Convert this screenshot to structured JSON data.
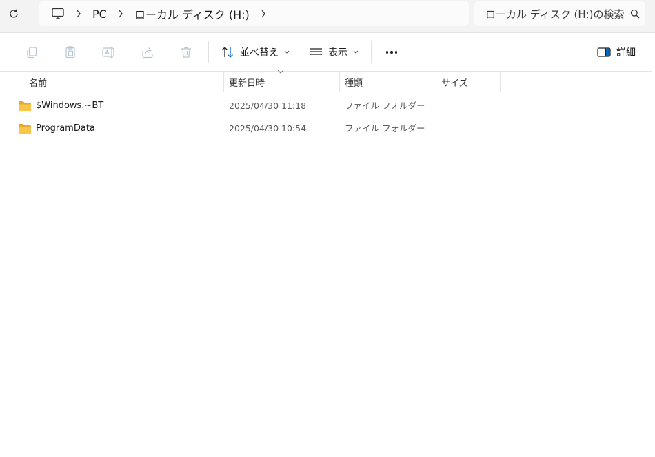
{
  "address_bar": {
    "breadcrumbs": [
      {
        "label": "PC"
      },
      {
        "label": "ローカル ディスク (H:)"
      }
    ],
    "icon": "computer-icon"
  },
  "search": {
    "placeholder": "ローカル ディスク (H:)の検索",
    "icon": "search-icon"
  },
  "toolbar": {
    "icons": [
      "copy-icon",
      "paste-icon",
      "rename-icon",
      "share-icon",
      "delete-icon"
    ],
    "sort_label": "並べ替え",
    "view_label": "表示",
    "more_icon": "more-options-icon",
    "details_label": "詳細"
  },
  "columns": {
    "name": "名前",
    "date": "更新日時",
    "type": "種類",
    "size": "サイズ"
  },
  "files": [
    {
      "name": "$Windows.~BT",
      "date": "2025/04/30 11:18",
      "type": "ファイル フォルダー",
      "size": ""
    },
    {
      "name": "ProgramData",
      "date": "2025/04/30 10:54",
      "type": "ファイル フォルダー",
      "size": ""
    }
  ],
  "colors": {
    "folder_yellow": "#f8c64a",
    "accent_blue": "#0067c0"
  }
}
